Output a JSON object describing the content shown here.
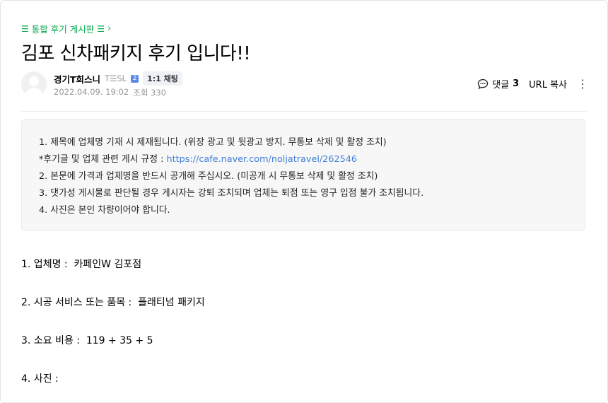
{
  "breadcrumb": {
    "menu_icon": "☰",
    "board_name": "통합 후기 게시판",
    "board_icon": "☰",
    "chevron": "›"
  },
  "post": {
    "title": "김포 신차패키지 후기 입니다!!"
  },
  "author": {
    "name": "경기T희스니",
    "grade": "T☰SL",
    "grade_badge": "2",
    "chat_label": "1:1 채팅",
    "date": "2022.04.09. 19:02",
    "views": "조회 330"
  },
  "tools": {
    "comment_label": "댓글",
    "comment_count": "3",
    "url_copy": "URL 복사",
    "more": "⋮"
  },
  "notice": {
    "line1": "1. 제목에 업체명 기재 시 제재됩니다. (위장 광고 및 뒷광고 방지. 무통보 삭제 및 활정 조치)",
    "line2_prefix": "*후기글 및 업체 관련 게시 규정 : ",
    "line2_link": "https://cafe.naver.com/noljatravel/262546",
    "line3": "2. 본문에 가격과 업체명을 반드시 공개해 주십시오. (미공개 시 무통보 삭제 및 활정 조치)",
    "line4": "3. 댓가성 게시물로 판단될 경우 게시자는 강퇴 조치되며 업체는 퇴점 또는 영구 입점 불가 조치됩니다.",
    "line5": "4. 사진은 본인 차량이어야 합니다."
  },
  "content": {
    "item1": "1. 업체명 :  카페인W 김포점",
    "item2": "2. 시공 서비스 또는 품목 :  플래티넘 패키지",
    "item3": "3. 소요 비용 :  119 + 35 + 5",
    "item4": "4. 사진 :"
  },
  "colors": {
    "accent_green": "#03a94d",
    "link_blue": "#3f7fd6",
    "notice_bg": "#f7f7f7"
  }
}
